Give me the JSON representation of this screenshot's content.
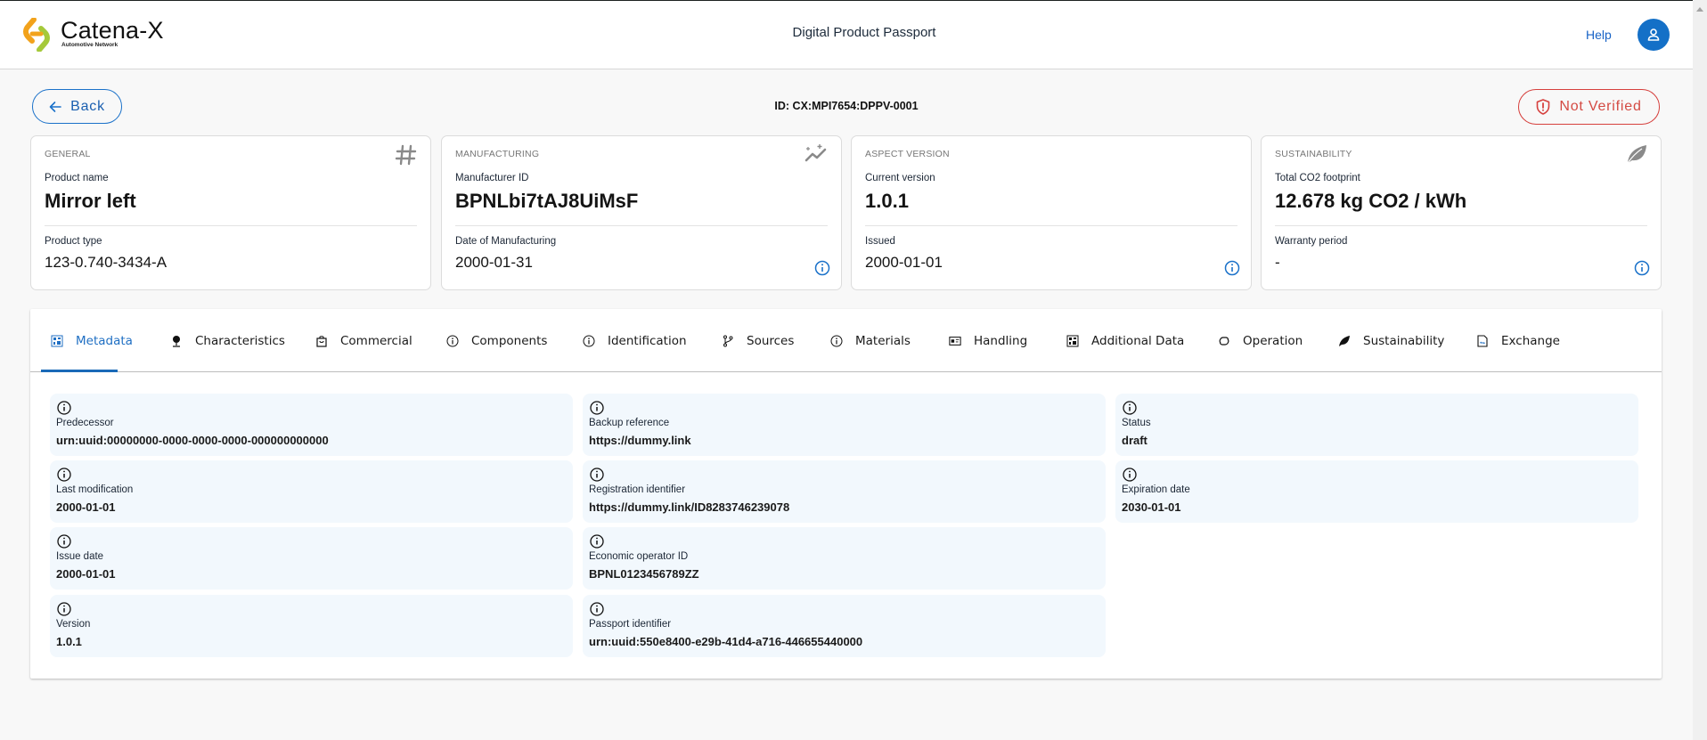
{
  "header": {
    "logo_title": "Catena-X",
    "logo_subtitle": "Automotive Network",
    "app_title": "Digital Product Passport",
    "help_label": "Help",
    "avatar_icon": "user-icon"
  },
  "toolbar": {
    "back_label": "Back",
    "passport_id": "ID: CX:MPI7654:DPPV-0001",
    "verification_label": "Not Verified",
    "verification_color": "#d6403d"
  },
  "cards": [
    {
      "category": "GENERAL",
      "icon": "hash-icon",
      "label1": "Product name",
      "value1": "Mirror left",
      "label2": "Product type",
      "value2": "123-0.740-3434-A",
      "has_info": false
    },
    {
      "category": "MANUFACTURING",
      "icon": "sparkle-chart-icon",
      "label1": "Manufacturer ID",
      "value1": "BPNLbi7tAJ8UiMsF",
      "label2": "Date of Manufacturing",
      "value2": "2000-01-31",
      "has_info": true
    },
    {
      "category": "ASPECT VERSION",
      "icon": "",
      "label1": "Current version",
      "value1": "1.0.1",
      "label2": "Issued",
      "value2": "2000-01-01",
      "has_info": true
    },
    {
      "category": "SUSTAINABILITY",
      "icon": "leaf-icon",
      "label1": "Total CO2 footprint",
      "value1": "12.678 kg CO2 / kWh",
      "label2": "Warranty period",
      "value2": "-",
      "has_info": true
    }
  ],
  "tabs": [
    {
      "label": "Metadata",
      "icon": "qr-code-icon",
      "active": true
    },
    {
      "label": "Characteristics",
      "icon": "pin-icon",
      "active": false
    },
    {
      "label": "Commercial",
      "icon": "shopping-bag-icon",
      "active": false
    },
    {
      "label": "Components",
      "icon": "info-icon",
      "active": false
    },
    {
      "label": "Identification",
      "icon": "info-icon",
      "active": false
    },
    {
      "label": "Sources",
      "icon": "branch-icon",
      "active": false
    },
    {
      "label": "Materials",
      "icon": "info-icon",
      "active": false
    },
    {
      "label": "Handling",
      "icon": "id-card-icon",
      "active": false
    },
    {
      "label": "Additional Data",
      "icon": "qr-code-icon",
      "active": false
    },
    {
      "label": "Operation",
      "icon": "link-icon",
      "active": false
    },
    {
      "label": "Sustainability",
      "icon": "leaf-icon",
      "active": false
    },
    {
      "label": "Exchange",
      "icon": "file-exchange-icon",
      "active": false
    }
  ],
  "metadata_fields": [
    {
      "label": "Predecessor",
      "value": "urn:uuid:00000000-0000-0000-0000-000000000000"
    },
    {
      "label": "Backup reference",
      "value": "https://dummy.link"
    },
    {
      "label": "Status",
      "value": "draft"
    },
    {
      "label": "Last modification",
      "value": "2000-01-01"
    },
    {
      "label": "Registration identifier",
      "value": "https://dummy.link/ID8283746239078"
    },
    {
      "label": "Expiration date",
      "value": "2030-01-01"
    },
    {
      "label": "Issue date",
      "value": "2000-01-01"
    },
    {
      "label": "Economic operator ID",
      "value": "BPNL0123456789ZZ"
    },
    {
      "label": "Version",
      "value": "1.0.1"
    },
    {
      "label": "Passport identifier",
      "value": "urn:uuid:550e8400-e29b-41d4-a716-446655440000"
    }
  ],
  "colors": {
    "accent": "#1a71c9",
    "field_bg": "#f2f8fd",
    "warning": "#d6403d"
  }
}
